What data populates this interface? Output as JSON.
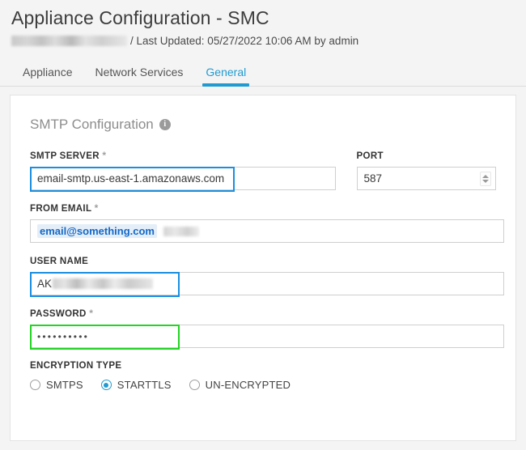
{
  "header": {
    "title": "Appliance Configuration - SMC",
    "redacted_label": "",
    "meta": "/ Last Updated: 05/27/2022 10:06 AM by admin"
  },
  "tabs": [
    {
      "label": "Appliance",
      "active": false
    },
    {
      "label": "Network Services",
      "active": false
    },
    {
      "label": "General",
      "active": true
    }
  ],
  "section": {
    "title": "SMTP Configuration",
    "info_icon": "info-icon"
  },
  "fields": {
    "smtp_server": {
      "label": "SMTP SERVER",
      "required": "*",
      "value": "email-smtp.us-east-1.amazonaws.com",
      "placeholder": "",
      "highlight": "#1a8fe0"
    },
    "port": {
      "label": "PORT",
      "required": "",
      "value": "587",
      "placeholder": "",
      "stepper_icon": "spinner-updown-icon"
    },
    "from_email": {
      "label": "FROM EMAIL",
      "required": "*",
      "value": "email@something.com",
      "placeholder": ""
    },
    "user_name": {
      "label": "USER NAME",
      "required": "",
      "value": "AK",
      "placeholder": "",
      "highlight": "#1a8fe0"
    },
    "password": {
      "label": "PASSWORD",
      "required": "*",
      "value": "••••••••••",
      "placeholder": "",
      "highlight": "#23d422"
    },
    "encryption_type": {
      "label": "ENCRYPTION TYPE",
      "options": [
        {
          "label": "SMTPS",
          "selected": false
        },
        {
          "label": "STARTTLS",
          "selected": true
        },
        {
          "label": "UN-ENCRYPTED",
          "selected": false
        }
      ]
    }
  },
  "colors": {
    "accent": "#1f9bd1",
    "annotation_blue": "#1a8fe0",
    "annotation_green": "#23d422",
    "link_blue": "#1569c7",
    "page_bg": "#f4f4f4"
  }
}
